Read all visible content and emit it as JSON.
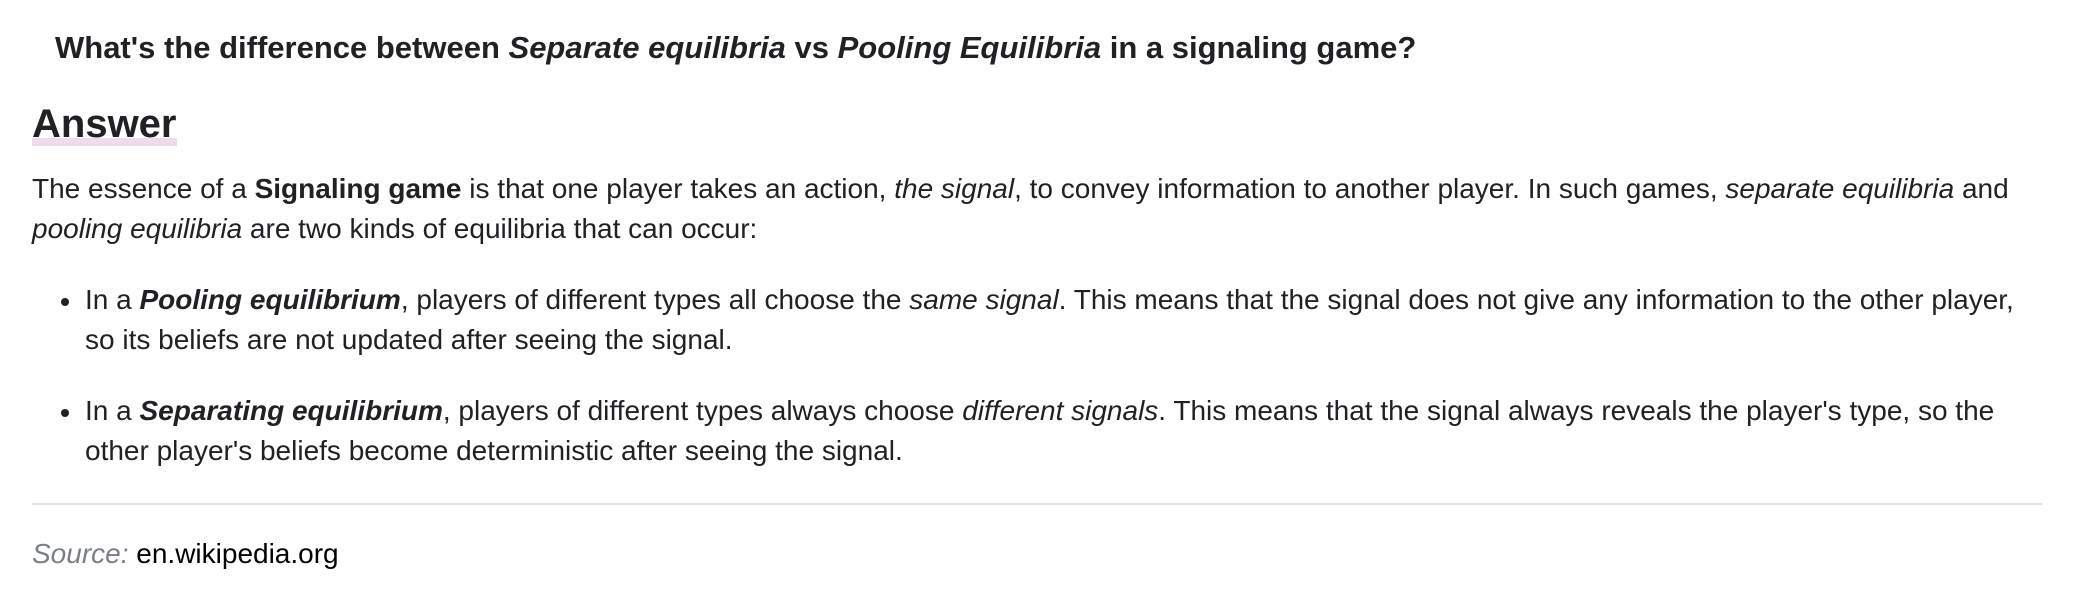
{
  "question": {
    "part1": "What's the difference between ",
    "term1": "Separate equilibria",
    "part2": " vs ",
    "term2": "Pooling Equilibria",
    "part3": " in a signaling game?"
  },
  "answer": {
    "heading": "Answer",
    "intro": {
      "t1": "The essence of a ",
      "b1": "Signaling game",
      "t2": " is that one player takes an action, ",
      "i1": "the signal",
      "t3": ", to convey information to another player. In such games, ",
      "i2": "separate equilibria",
      "t4": " and ",
      "i3": "pooling equilibria",
      "t5": " are two kinds of equilibria that can occur:"
    },
    "bullets": [
      {
        "t1": "In a ",
        "bi": "Pooling equilibrium",
        "t2": ", players of different types all choose the ",
        "i": "same signal",
        "t3": ". This means that the signal does not give any information to the other player, so its beliefs are not updated after seeing the signal."
      },
      {
        "t1": "In a ",
        "bi": "Separating equilibrium",
        "t2": ", players of different types always choose ",
        "i": "different signals",
        "t3": ". This means that the signal always reveals the player's type, so the other player's beliefs become deterministic after seeing the signal."
      }
    ]
  },
  "source": {
    "label": "Source:",
    "link_text": "en.wikipedia.org"
  },
  "colors": {
    "text": "#202124",
    "muted": "#7a7f87",
    "heading_highlight": "#ecdcec",
    "divider": "#e3e3e3"
  }
}
